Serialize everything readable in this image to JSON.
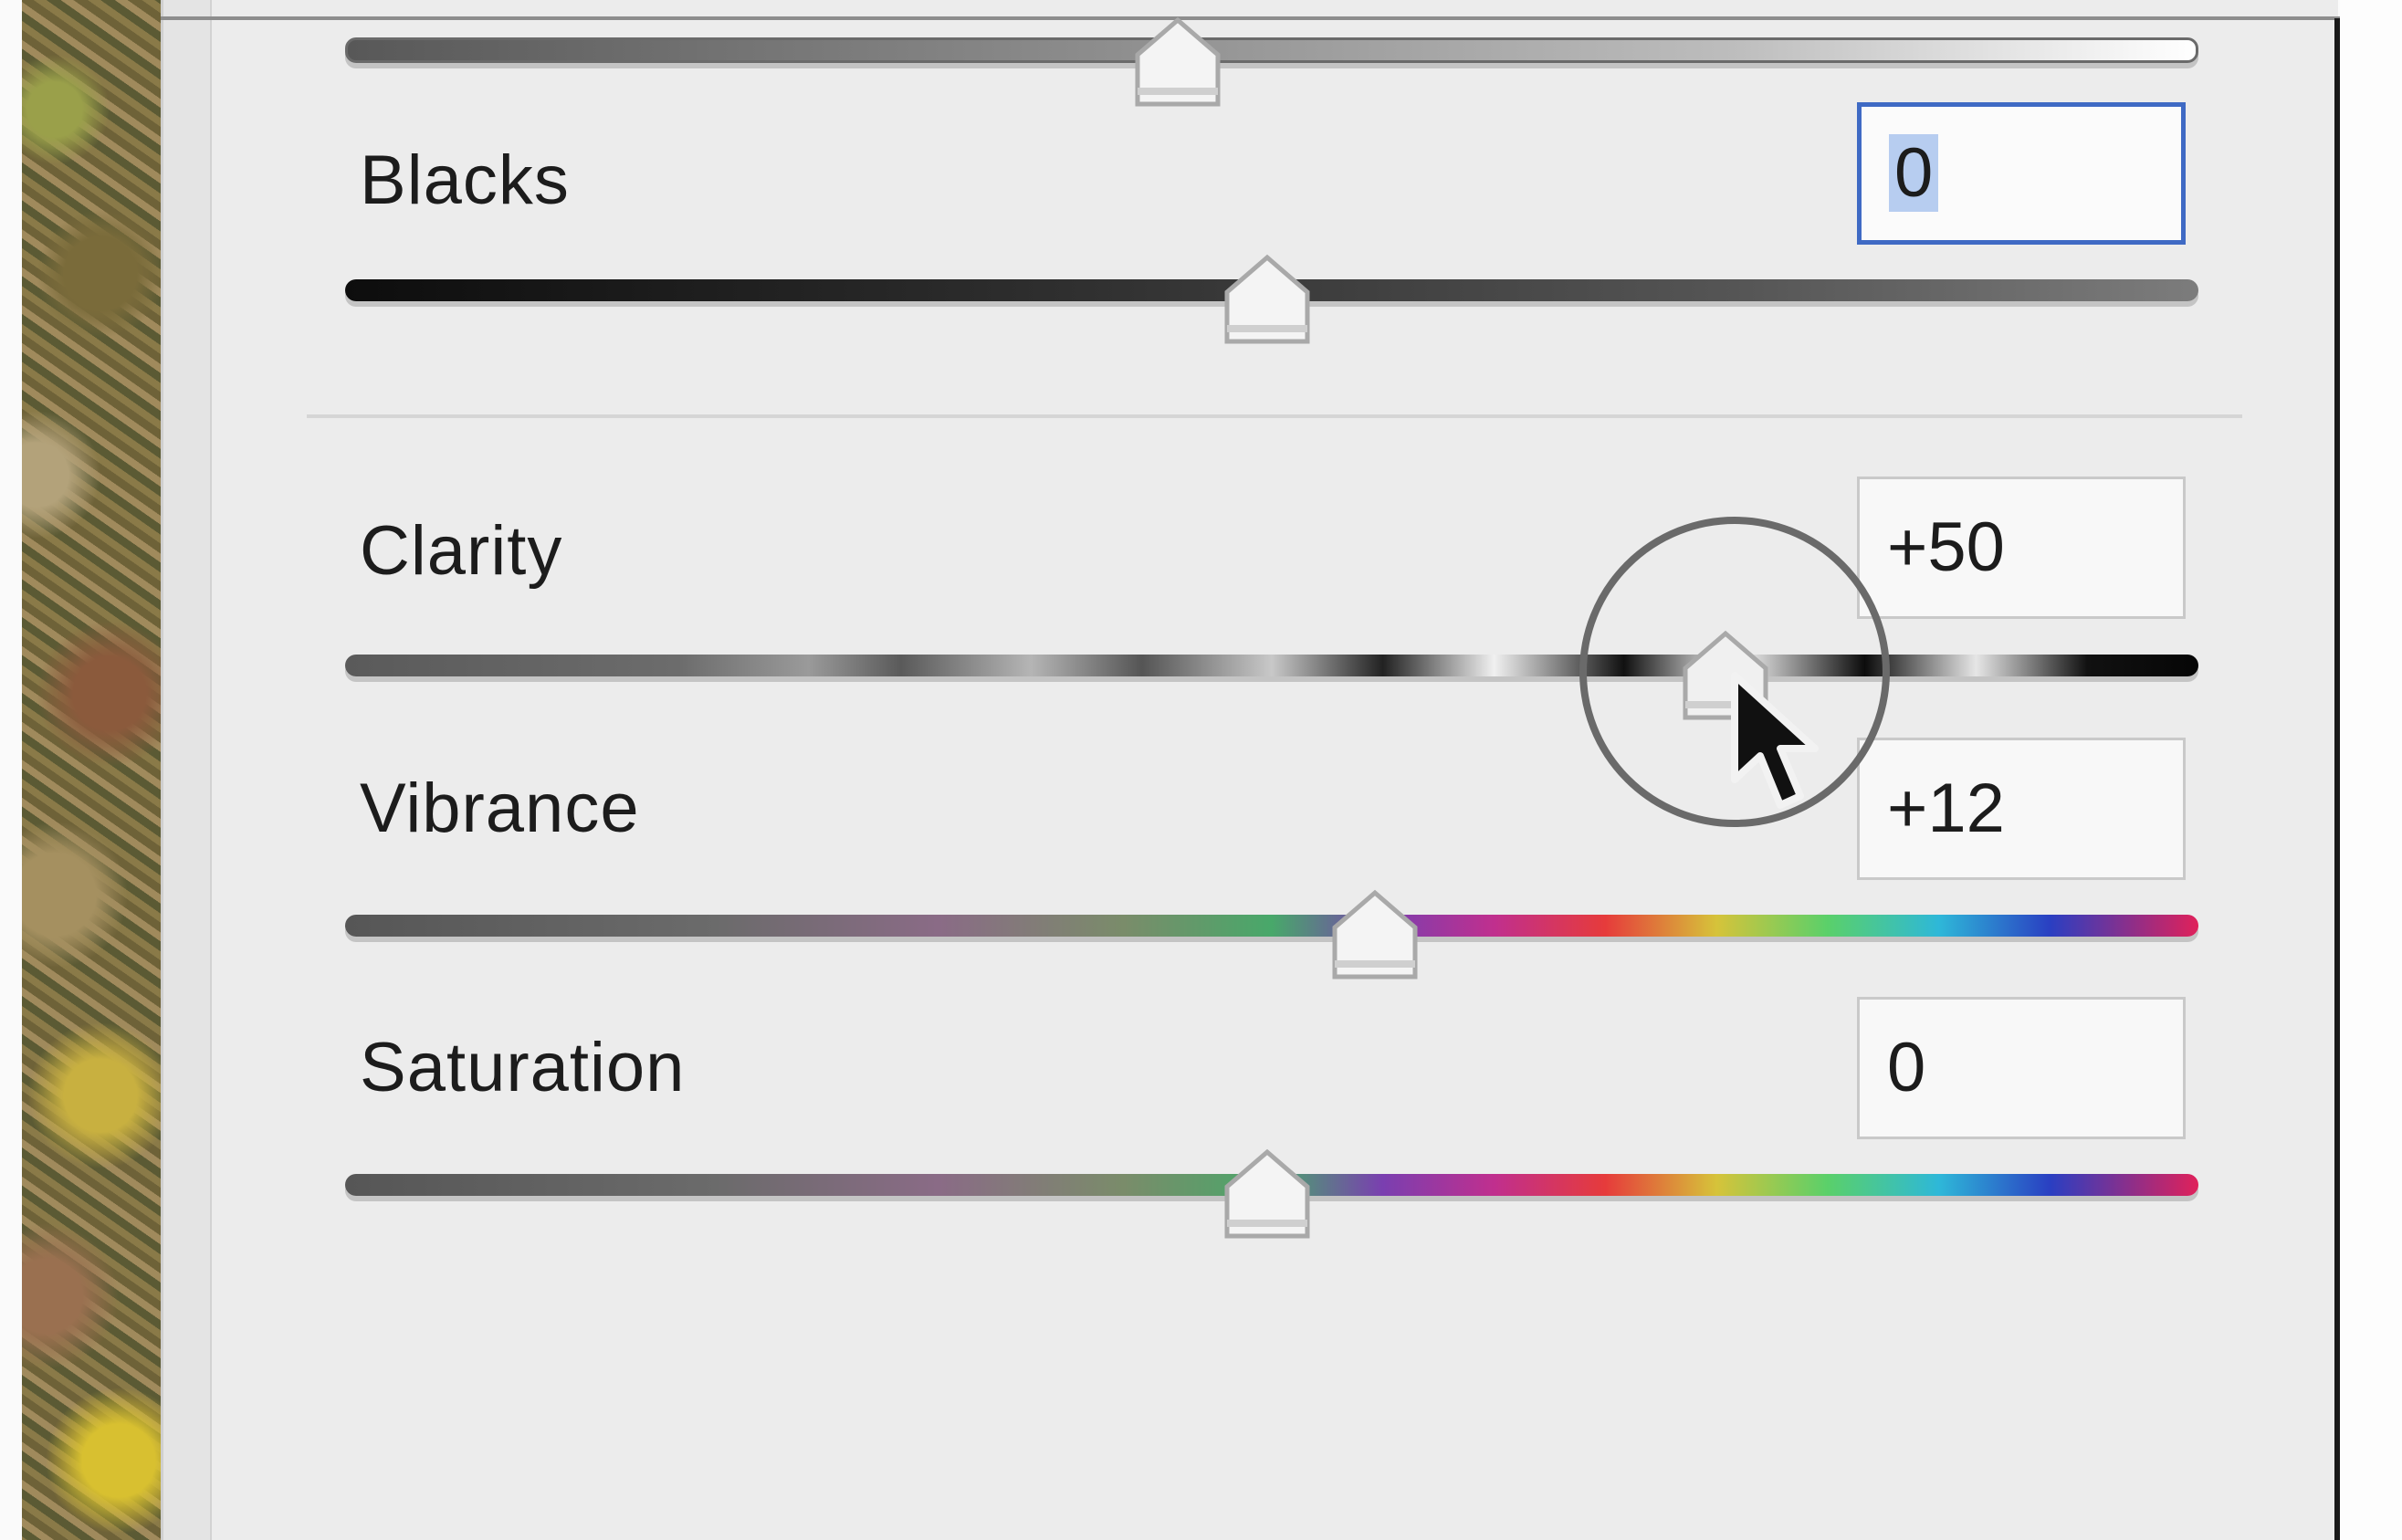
{
  "panel": {
    "sliders": [
      {
        "id": "top-partial",
        "label": "",
        "value": ""
      },
      {
        "id": "blacks",
        "label": "Blacks",
        "value": "0",
        "selected": true
      },
      {
        "id": "clarity",
        "label": "Clarity",
        "value": "+50",
        "active": true
      },
      {
        "id": "vibrance",
        "label": "Vibrance",
        "value": "+12"
      },
      {
        "id": "saturation",
        "label": "Saturation",
        "value": "0"
      }
    ]
  },
  "colors": {
    "focus_border": "#3f6ac4",
    "selection_highlight": "#b7cdf0",
    "panel_background": "#ececec"
  },
  "icons": {
    "cursor": "arrow-pointer-icon",
    "slider_thumb": "slider-thumb-icon"
  }
}
